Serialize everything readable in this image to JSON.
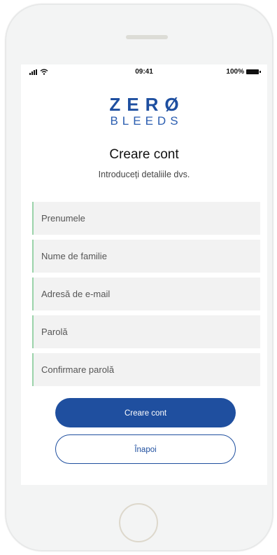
{
  "status_bar": {
    "time": "09:41",
    "battery": "100%",
    "icons": [
      "signal-icon",
      "wifi-icon",
      "battery-icon"
    ]
  },
  "logo": {
    "top": "ZERØ",
    "bottom": "BLEEDS"
  },
  "page": {
    "title": "Creare cont",
    "subtitle": "Introduceți detaliile dvs."
  },
  "form": {
    "first_name_placeholder": "Prenumele",
    "last_name_placeholder": "Nume de familie",
    "email_placeholder": "Adresă de e-mail",
    "password_placeholder": "Parolă",
    "confirm_password_placeholder": "Confirmare parolă"
  },
  "buttons": {
    "create_label": "Creare cont",
    "back_label": "Înapoi"
  },
  "colors": {
    "brand_blue": "#1f4f9f",
    "field_accent": "#9bd3aa",
    "field_bg": "#f2f2f2"
  }
}
